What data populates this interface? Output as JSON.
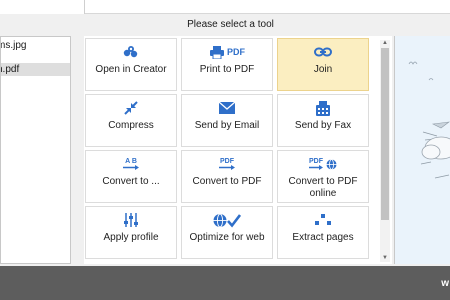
{
  "prompt": "Please select a tool",
  "files": [
    {
      "name": "ms.jpg"
    },
    {
      "name": "n.pdf"
    }
  ],
  "tools": [
    {
      "label": "Open in Creator",
      "icon": "open-in-creator-icon"
    },
    {
      "label": "Print to PDF",
      "icon": "printer-pdf-icon",
      "icon_text": "PDF"
    },
    {
      "label": "Join",
      "icon": "chain-link-icon",
      "selected": true
    },
    {
      "label": "Compress",
      "icon": "compress-arrows-icon"
    },
    {
      "label": "Send by Email",
      "icon": "envelope-icon"
    },
    {
      "label": "Send by Fax",
      "icon": "fax-icon"
    },
    {
      "label": "Convert to ...",
      "icon": "convert-ab-icon",
      "icon_text": "A B"
    },
    {
      "label": "Convert to PDF",
      "icon": "convert-pdf-icon",
      "icon_text": "PDF"
    },
    {
      "label": "Convert to PDF online",
      "icon": "convert-pdf-online-icon",
      "icon_text": "PDF"
    },
    {
      "label": "Apply profile",
      "icon": "sliders-icon"
    },
    {
      "label": "Optimize for web",
      "icon": "globe-check-icon"
    },
    {
      "label": "Extract pages",
      "icon": "extract-pages-icon"
    }
  ],
  "bottom_text": "w",
  "colors": {
    "accent": "#2f6fc9",
    "selected_tile": "#fbeec1",
    "bottom_bar": "#5d5d5d"
  }
}
